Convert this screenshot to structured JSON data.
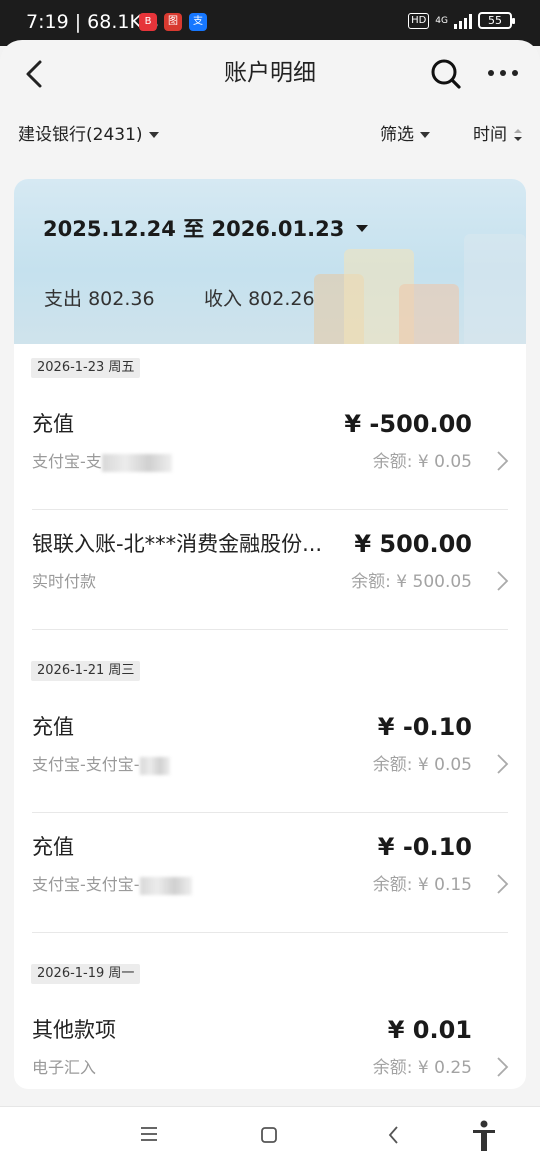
{
  "status_bar": {
    "time": "7:19 | 68.1K/s",
    "app_icons": [
      {
        "icon": "bilibili-app-icon",
        "glyph": "B",
        "color": "#e6343a"
      },
      {
        "icon": "news-app-icon",
        "glyph": "图",
        "color": "#d83a30"
      },
      {
        "icon": "alipay-app-icon",
        "glyph": "支",
        "color": "#1677ff"
      }
    ],
    "hd": "HD",
    "network": "4G",
    "battery": "55"
  },
  "header": {
    "title": "账户明细",
    "back_icon": "back-arrow-icon",
    "search_icon": "search-icon",
    "more_icon": "more-dots-icon"
  },
  "filters": {
    "account": "建设银行(2431)",
    "screen": "筛选",
    "time": "时间"
  },
  "summary": {
    "date_range": "2025.12.24 至 2026.01.23",
    "expense_label": "支出",
    "expense_value": "802.36",
    "income_label": "收入",
    "income_value": "802.26"
  },
  "groups": [
    {
      "date": "2026-1-23 周五",
      "items": [
        {
          "title": "充值",
          "amount": "¥ -500.00",
          "subtitle": "支付宝-支",
          "balance": "余额: ¥ 0.05"
        },
        {
          "title": "银联入账-北***消费金融股份...",
          "amount": "¥ 500.00",
          "subtitle": "实时付款",
          "balance": "余额: ¥ 500.05"
        }
      ]
    },
    {
      "date": "2026-1-21 周三",
      "items": [
        {
          "title": "充值",
          "amount": "¥ -0.10",
          "subtitle": "支付宝-支付宝-",
          "balance": "余额: ¥ 0.05"
        },
        {
          "title": "充值",
          "amount": "¥ -0.10",
          "subtitle": "支付宝-支付宝-",
          "balance": "余额: ¥ 0.15"
        }
      ]
    },
    {
      "date": "2026-1-19 周一",
      "items": [
        {
          "title": "其他款项",
          "amount": "¥ 0.01",
          "subtitle": "电子汇入",
          "balance": "余额: ¥ 0.25"
        }
      ]
    }
  ],
  "nav_bar": {
    "menu_icon": "menu-lines-icon",
    "home_icon": "home-square-icon",
    "back_icon": "nav-back-icon",
    "accessibility_icon": "accessibility-icon"
  }
}
